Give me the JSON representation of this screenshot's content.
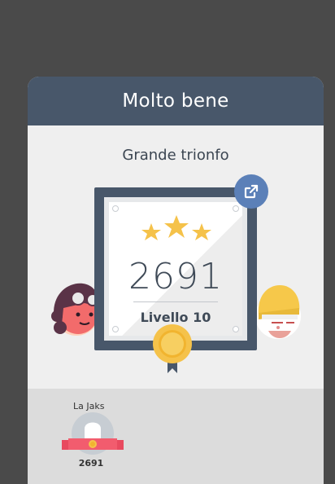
{
  "header": {
    "title": "Molto bene"
  },
  "subtitle": "Grande trionfo",
  "trophy": {
    "score": "2691",
    "level_label": "Livello 10",
    "stars": 3
  },
  "share": {
    "icon": "share-icon"
  },
  "leaderboard": {
    "player": {
      "name": "La Jaks",
      "score": "2691"
    }
  },
  "colors": {
    "header": "#48576a",
    "card": "#efefef",
    "accent_blue": "#5b80b8",
    "gold": "#f5c24a",
    "ribbon": "#f25c6e"
  }
}
